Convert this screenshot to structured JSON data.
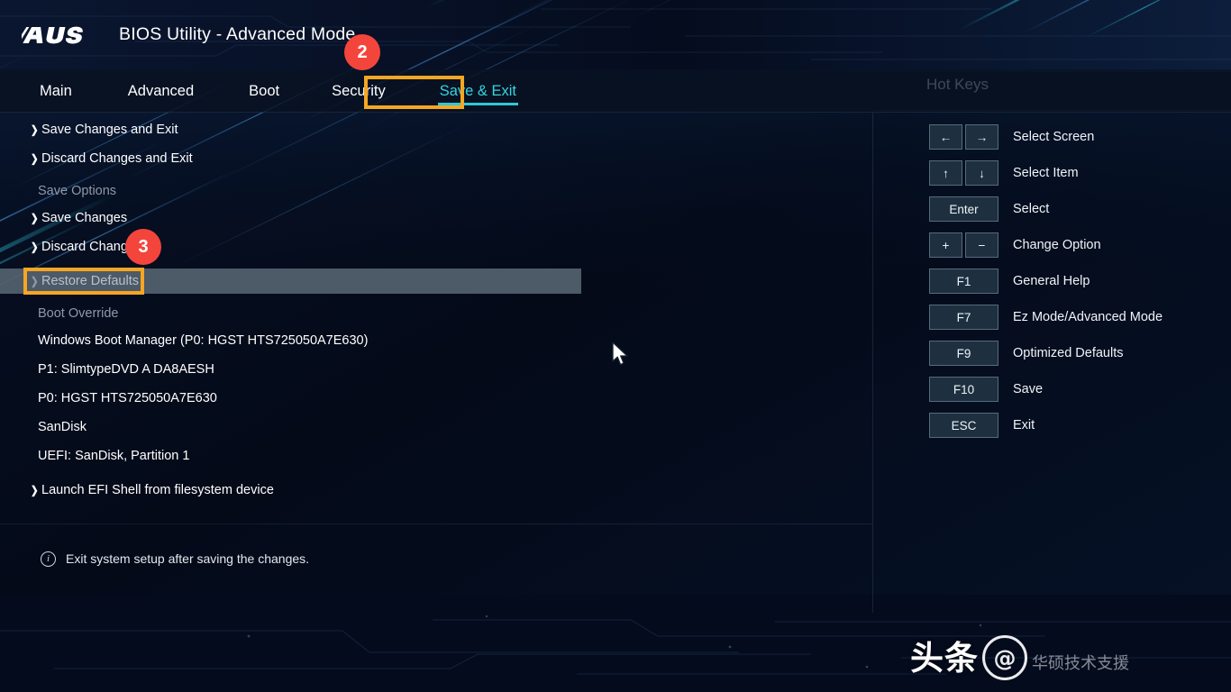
{
  "header": {
    "logo": "ASUS",
    "title": "BIOS Utility - Advanced Mode"
  },
  "nav": {
    "items": [
      {
        "label": "Main"
      },
      {
        "label": "Advanced"
      },
      {
        "label": "Boot"
      },
      {
        "label": "Security"
      },
      {
        "label": "Save & Exit"
      }
    ],
    "active_index": 4
  },
  "menu": {
    "rows": [
      {
        "label": "Save Changes and Exit",
        "kind": "item"
      },
      {
        "label": "Discard Changes and Exit",
        "kind": "item"
      },
      {
        "label": "Save Options",
        "kind": "section"
      },
      {
        "label": "Save Changes",
        "kind": "item"
      },
      {
        "label": "Discard Changes",
        "kind": "item"
      },
      {
        "label": "Restore Defaults",
        "kind": "item-selected"
      },
      {
        "label": "Boot Override",
        "kind": "section"
      },
      {
        "label": "Windows Boot Manager (P0: HGST HTS725050A7E630)",
        "kind": "plain"
      },
      {
        "label": "P1: SlimtypeDVD A  DA8AESH",
        "kind": "plain"
      },
      {
        "label": "P0: HGST HTS725050A7E630",
        "kind": "plain"
      },
      {
        "label": "SanDisk",
        "kind": "plain"
      },
      {
        "label": "UEFI: SanDisk, Partition 1",
        "kind": "plain"
      },
      {
        "label": "Launch EFI Shell from filesystem device",
        "kind": "item"
      }
    ],
    "chevron": "❯"
  },
  "status": {
    "icon": "i",
    "text": "Exit system setup after saving the changes."
  },
  "hotkeys": {
    "title": "Hot Keys",
    "rows": [
      {
        "keys": [
          "←",
          "→"
        ],
        "desc": "Select Screen",
        "style": "pair"
      },
      {
        "keys": [
          "↑",
          "↓"
        ],
        "desc": "Select Item",
        "style": "pair"
      },
      {
        "keys": [
          "Enter"
        ],
        "desc": "Select",
        "style": "wide"
      },
      {
        "keys": [
          "+",
          "−"
        ],
        "desc": "Change Option",
        "style": "pair"
      },
      {
        "keys": [
          "F1"
        ],
        "desc": "General Help",
        "style": "wide"
      },
      {
        "keys": [
          "F7"
        ],
        "desc": "Ez Mode/Advanced Mode",
        "style": "wide"
      },
      {
        "keys": [
          "F9"
        ],
        "desc": "Optimized Defaults",
        "style": "wide"
      },
      {
        "keys": [
          "F10"
        ],
        "desc": "Save",
        "style": "wide"
      },
      {
        "keys": [
          "ESC"
        ],
        "desc": "Exit",
        "style": "wide"
      }
    ]
  },
  "annotations": {
    "badges": [
      {
        "number": "2"
      },
      {
        "number": "3"
      }
    ],
    "highlight_color": "#f5a623",
    "badge_color": "#f4453c"
  },
  "watermark": {
    "text": "头条",
    "logo": "@",
    "brand": "华硕技术支援"
  },
  "colors": {
    "accent_cyan": "#2fc8d8",
    "background": "#050c1a",
    "selection": "#5a6876"
  }
}
